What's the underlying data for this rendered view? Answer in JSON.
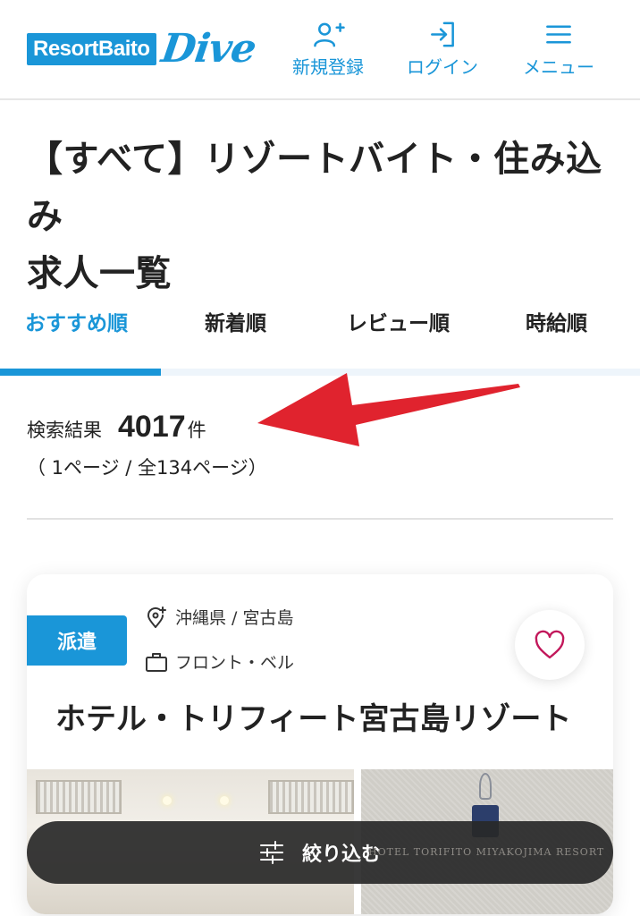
{
  "header": {
    "logo_text": "ResortBaito",
    "logo_script": "Dive",
    "nav": [
      {
        "label": "新規登録",
        "icon": "user-plus-icon"
      },
      {
        "label": "ログイン",
        "icon": "login-icon"
      },
      {
        "label": "メニュー",
        "icon": "hamburger-icon"
      }
    ]
  },
  "page": {
    "title_line1": "【すべて】リゾートバイト・住み込み",
    "title_line2": "求人一覧"
  },
  "tabs": [
    {
      "label": "おすすめ順",
      "active": true
    },
    {
      "label": "新着順",
      "active": false
    },
    {
      "label": "レビュー順",
      "active": false
    },
    {
      "label": "時給順",
      "active": false
    }
  ],
  "results": {
    "label": "検索結果",
    "count": "4017",
    "unit": "件",
    "pages": "（ 1ページ /  全134ページ）"
  },
  "card": {
    "badge": "派遣",
    "location": "沖縄県 / 宮古島",
    "job_type": "フロント・ベル",
    "title": "ホテル・トリフィート宮古島リゾート",
    "photo_caption": "HOTEL TORIFITO MIYAKOJIMA RESORT"
  },
  "filter": {
    "label": "絞り込む"
  },
  "colors": {
    "accent": "#1a96d8",
    "annotation_arrow": "#e0232e",
    "favorite": "#c2185b"
  }
}
